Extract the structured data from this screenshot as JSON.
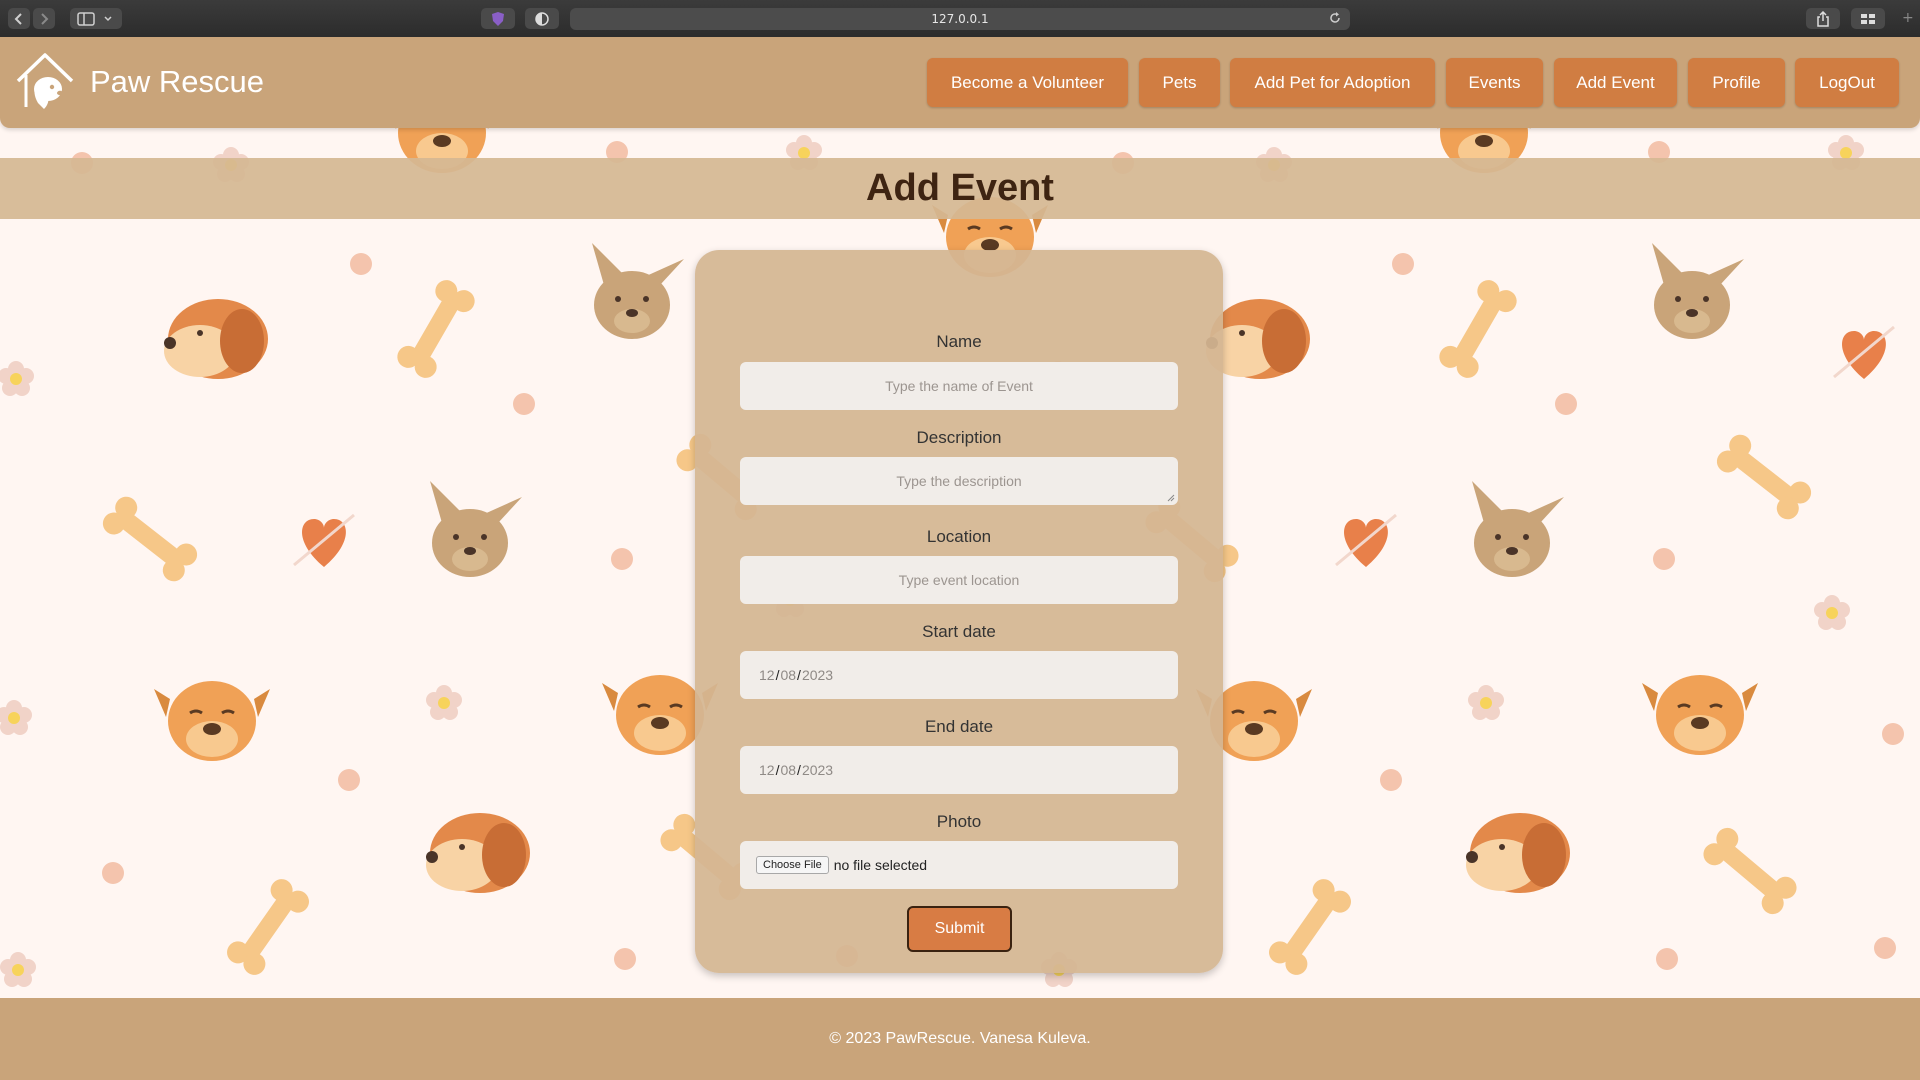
{
  "browser": {
    "url": "127.0.0.1"
  },
  "brand": {
    "name": "Paw Rescue"
  },
  "nav": {
    "items": [
      {
        "label": "Become a Volunteer"
      },
      {
        "label": "Pets"
      },
      {
        "label": "Add Pet for Adoption"
      },
      {
        "label": "Events"
      },
      {
        "label": "Add Event"
      },
      {
        "label": "Profile"
      },
      {
        "label": "LogOut"
      }
    ]
  },
  "page": {
    "title": "Add Event"
  },
  "form": {
    "name": {
      "label": "Name",
      "placeholder": "Type the name of Event"
    },
    "description": {
      "label": "Description",
      "placeholder": "Type the description"
    },
    "location": {
      "label": "Location",
      "placeholder": "Type event location"
    },
    "start_date": {
      "label": "Start date",
      "month": "12",
      "day": "08",
      "year": "2023"
    },
    "end_date": {
      "label": "End date",
      "month": "12",
      "day": "08",
      "year": "2023"
    },
    "photo": {
      "label": "Photo",
      "button": "Choose File",
      "status": "no file selected"
    },
    "submit": "Submit"
  },
  "footer": {
    "text": "© 2023 PawRescue. Vanesa Kuleva."
  },
  "colors": {
    "navbar": "#c9a47a",
    "accent": "#d07d42",
    "background": "#fff6f2",
    "card": "#d4b692"
  }
}
